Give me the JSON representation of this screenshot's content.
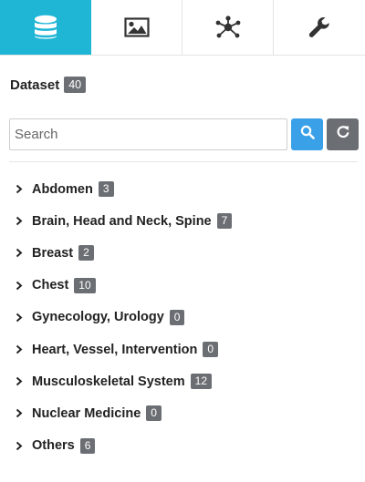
{
  "tabs": [
    {
      "icon": "database-icon",
      "active": true
    },
    {
      "icon": "image-icon",
      "active": false
    },
    {
      "icon": "network-icon",
      "active": false
    },
    {
      "icon": "wrench-icon",
      "active": false
    }
  ],
  "dataset": {
    "title": "Dataset",
    "count": "40"
  },
  "search": {
    "placeholder": "Search",
    "value": ""
  },
  "categories": [
    {
      "label": "Abdomen",
      "count": "3"
    },
    {
      "label": "Brain, Head and Neck, Spine",
      "count": "7"
    },
    {
      "label": "Breast",
      "count": "2"
    },
    {
      "label": "Chest",
      "count": "10"
    },
    {
      "label": "Gynecology, Urology",
      "count": "0"
    },
    {
      "label": "Heart, Vessel, Intervention",
      "count": "0"
    },
    {
      "label": "Musculoskeletal System",
      "count": "12"
    },
    {
      "label": "Nuclear Medicine",
      "count": "0"
    },
    {
      "label": "Others",
      "count": "6"
    }
  ],
  "colors": {
    "active_tab": "#1fb6d6",
    "search_button": "#3aa1e8",
    "badge": "#6b6f74"
  }
}
